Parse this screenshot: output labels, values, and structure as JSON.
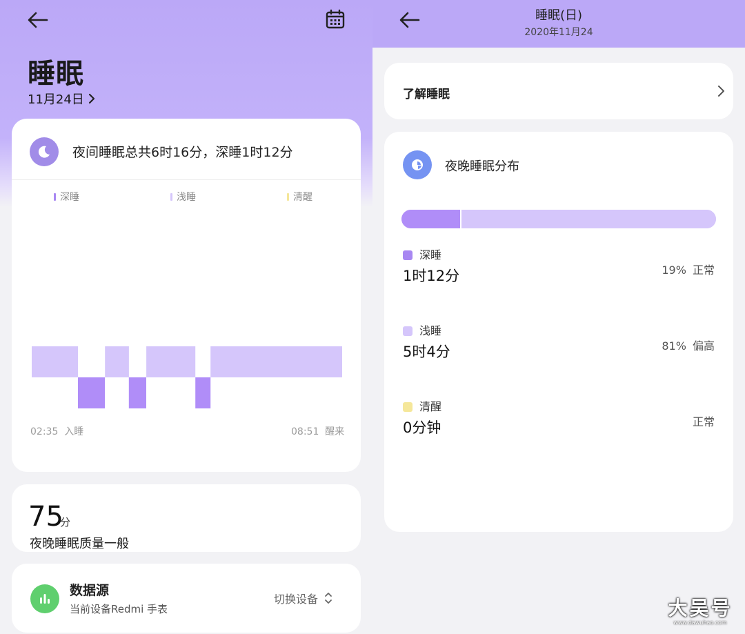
{
  "left": {
    "title": "睡眠",
    "date_label": "11月24日",
    "summary": {
      "text": "夜间睡眠总共6时16分，深睡1时12分",
      "legend": [
        {
          "label": "深睡",
          "color": "#a887f2"
        },
        {
          "label": "浅睡",
          "color": "#d5c6fb"
        },
        {
          "label": "清醒",
          "color": "#f5e79a"
        }
      ],
      "start_time": "02:35",
      "start_label": "入睡",
      "end_time": "08:51",
      "end_label": "醒来"
    },
    "chart_data": {
      "type": "bar",
      "categories": [
        "深睡",
        "浅睡",
        "清醒"
      ],
      "x_range": [
        "02:35",
        "08:51"
      ],
      "segments": [
        {
          "stage": "浅睡",
          "start": 0.0,
          "end": 0.149
        },
        {
          "stage": "深睡",
          "start": 0.149,
          "end": 0.236
        },
        {
          "stage": "浅睡",
          "start": 0.236,
          "end": 0.313
        },
        {
          "stage": "深睡",
          "start": 0.313,
          "end": 0.369
        },
        {
          "stage": "浅睡",
          "start": 0.369,
          "end": 0.527
        },
        {
          "stage": "深睡",
          "start": 0.527,
          "end": 0.576
        },
        {
          "stage": "浅睡",
          "start": 0.576,
          "end": 1.0
        }
      ]
    },
    "score": {
      "value": "75",
      "unit": "分",
      "description": "夜晚睡眠质量一般"
    },
    "source": {
      "title": "数据源",
      "device": "当前设备Redmi 手表",
      "switch_label": "切换设备"
    }
  },
  "right": {
    "title": "睡眠(日)",
    "subtitle": "2020年11月24",
    "learn_label": "了解睡眠",
    "distribution": {
      "title": "夜晚睡眠分布",
      "stages": [
        {
          "name": "深睡",
          "duration": "1时12分",
          "percent": "19%",
          "status": "正常",
          "color": "#a887f2",
          "fraction": 0.19
        },
        {
          "name": "浅睡",
          "duration": "5时4分",
          "percent": "81%",
          "status": "偏高",
          "color": "#d5c6fb",
          "fraction": 0.81
        },
        {
          "name": "清醒",
          "duration": "0分钟",
          "percent": "",
          "status": "正常",
          "color": "#f5e79a",
          "fraction": 0.0
        }
      ]
    }
  },
  "watermark": {
    "text": "大吴号",
    "url": "www.dawuhao.com"
  },
  "colors": {
    "header": "#bba8f7",
    "deep": "#a887f2",
    "light": "#d5c6fb",
    "awake": "#f5e79a",
    "deep_bar": "#b08df8"
  }
}
